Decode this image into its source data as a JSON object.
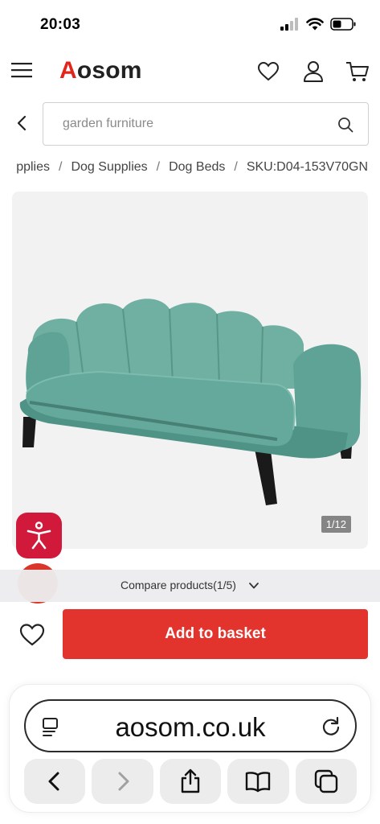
{
  "status": {
    "time": "20:03"
  },
  "header": {
    "logo_first": "A",
    "logo_rest": "osom"
  },
  "search": {
    "placeholder": "garden furniture"
  },
  "breadcrumb": {
    "items": [
      "pplies",
      "Dog Supplies",
      "Dog Beds",
      "SKU:D04-153V70GN"
    ],
    "separator": "/"
  },
  "product": {
    "image_counter": "1/12",
    "image_subject": "teal velvet scallop-back pet sofa with black legs",
    "colors": {
      "sofa": "#5fa396"
    }
  },
  "compare": {
    "label": "Compare products(1/5)"
  },
  "actions": {
    "add_to_basket": "Add to basket"
  },
  "browser": {
    "url": "aosom.co.uk"
  },
  "colors": {
    "brand": "#e1251b",
    "button": "#e3332d",
    "accessibility": "#d11a3b"
  }
}
